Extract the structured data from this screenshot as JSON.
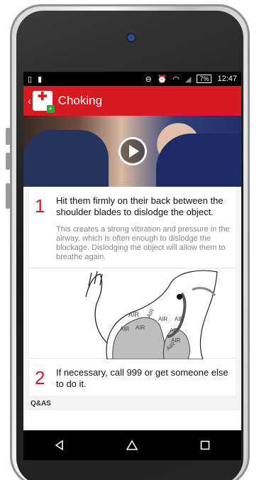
{
  "status_bar": {
    "battery_percent": "7%",
    "time": "12:47"
  },
  "app_bar": {
    "title": "Choking"
  },
  "steps": [
    {
      "number": "1",
      "title": "Hit them firmly on their back between the shoulder blades to dislodge the object.",
      "description": "This creates a strong vibration and pressure in the airway, which is often enough to dislodge the blockage. Dislodging the object will allow them to breathe again."
    },
    {
      "number": "2",
      "title": "If necessary, call 999 or get someone else to do it."
    }
  ],
  "illustration": {
    "labels": [
      "AIR",
      "AIR",
      "AIR",
      "AIR",
      "AIR",
      "AIR",
      "AIR",
      "AIR",
      "AIR"
    ]
  },
  "section_label": "Q&AS",
  "colors": {
    "brand_red": "#d71921",
    "badge_green": "#3aa035"
  }
}
